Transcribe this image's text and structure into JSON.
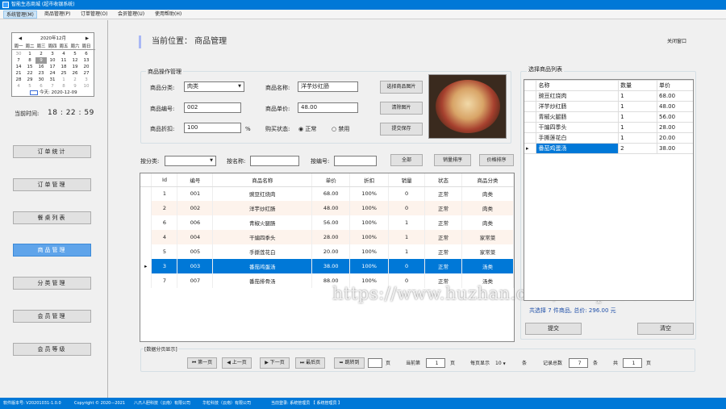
{
  "window": {
    "title": "智能生态商城 (超市收银系统)"
  },
  "menu": [
    "系统管理(M)",
    "商品管理(P)",
    "订单管理(O)",
    "会员管理(U)",
    "使用帮助(H)"
  ],
  "calendar": {
    "month_label": "2020年12月",
    "weekdays": [
      "周一",
      "周二",
      "周三",
      "周四",
      "周五",
      "周六",
      "周日"
    ],
    "rows": [
      [
        "30",
        "1",
        "2",
        "3",
        "4",
        "5",
        "6"
      ],
      [
        "7",
        "8",
        "9",
        "10",
        "11",
        "12",
        "13"
      ],
      [
        "14",
        "15",
        "16",
        "17",
        "18",
        "19",
        "20"
      ],
      [
        "21",
        "22",
        "23",
        "24",
        "25",
        "26",
        "27"
      ],
      [
        "28",
        "29",
        "30",
        "31",
        "1",
        "2",
        "3"
      ],
      [
        "4",
        "5",
        "6",
        "7",
        "8",
        "9",
        "10"
      ]
    ],
    "today_label": "今天: 2020-12-09"
  },
  "time": {
    "label": "当前时间:",
    "value": "18 : 22 : 59"
  },
  "nav": [
    "订单统计",
    "订单管理",
    "餐桌列表",
    "商品管理",
    "分类管理",
    "会员管理",
    "会员等级"
  ],
  "header": {
    "location": "当前位置：  商品管理",
    "close": "关闭窗口"
  },
  "product_form": {
    "group_title": "商品操作管理",
    "category_label": "商品分类:",
    "category_value": "肉类",
    "name_label": "商品名称:",
    "name_value": "洋芋炒红肠",
    "code_label": "商品编号:",
    "code_value": "002",
    "price_label": "商品单价:",
    "price_value": "48.00",
    "discount_label": "商品折扣:",
    "discount_value": "100",
    "percent": "%",
    "status_label": "购买状态:",
    "status_normal": "正常",
    "status_disabled": "禁用",
    "btn_select_image": "选择商品图片",
    "btn_clear_image": "清除图片",
    "btn_save": "提交保存"
  },
  "filters": {
    "by_category": "按分类:",
    "by_name": "按名称:",
    "by_code": "按编号:",
    "btn_all": "全部",
    "btn_sort_sales": "销量排序",
    "btn_sort_price": "价格排序"
  },
  "product_table": {
    "headers": [
      "Id",
      "编号",
      "商品名称",
      "单价",
      "折扣",
      "销量",
      "状态",
      "商品分类"
    ],
    "rows": [
      [
        "1",
        "001",
        "豌豆红烧肉",
        "68.00",
        "100%",
        "0",
        "正常",
        "肉类"
      ],
      [
        "2",
        "002",
        "洋芋炒红肠",
        "48.00",
        "100%",
        "0",
        "正常",
        "肉类"
      ],
      [
        "6",
        "006",
        "青椒火腿肠",
        "56.00",
        "100%",
        "1",
        "正常",
        "肉类"
      ],
      [
        "4",
        "004",
        "干煸四季头",
        "28.00",
        "100%",
        "1",
        "正常",
        "家常菜"
      ],
      [
        "5",
        "005",
        "手撕莲花白",
        "20.00",
        "100%",
        "1",
        "正常",
        "家常菜"
      ],
      [
        "3",
        "003",
        "番茄鸡蛋汤",
        "38.00",
        "100%",
        "0",
        "正常",
        "汤类"
      ],
      [
        "7",
        "007",
        "番茄排骨汤",
        "88.00",
        "100%",
        "0",
        "正常",
        "汤类"
      ]
    ]
  },
  "pager": {
    "title": "[数据分页显示]",
    "first": "第一页",
    "prev": "上一页",
    "next": "下一页",
    "last": "最后页",
    "jump": "跳转到",
    "page_unit": "页",
    "current_label": "当前第",
    "current": "1",
    "per_page_label": "每页显示",
    "per_page": "10",
    "per_unit": "条",
    "total_label": "记录总数",
    "total": "7",
    "total_unit": "条",
    "pages_label": "共",
    "pages": "1",
    "pages_unit": "页"
  },
  "cart": {
    "title": "选择商品列表",
    "headers": [
      "名称",
      "数量",
      "单价"
    ],
    "rows": [
      [
        "豌豆红烧肉",
        "1",
        "68.00"
      ],
      [
        "洋芋炒红肠",
        "1",
        "48.00"
      ],
      [
        "青椒火腿肠",
        "1",
        "56.00"
      ],
      [
        "干煸四季头",
        "1",
        "28.00"
      ],
      [
        "手撕莲花白",
        "1",
        "20.00"
      ],
      [
        "番茄鸡蛋汤",
        "2",
        "38.00"
      ]
    ],
    "summary": "共选择 7 件商品,  总价:  296.00  元",
    "btn_submit": "提交",
    "btn_clear": "清空"
  },
  "status_bar": {
    "version": "软件版本号: V20201031-1.0.0",
    "copyright": "Copyright © 2020—2021",
    "company1": "八爪人胆科技（云南）有限公司",
    "company2": "华粒科技（云南）有限公司",
    "login": "当前登录: 系统管理员 【 系统管理员 】"
  },
  "watermark": "https://www.huzhan.com/ishop9907",
  "colors": {
    "accent": "#0078d7",
    "selected_row": "#0078d7",
    "nav_active": "#5fa4ea",
    "alt_row": "#fdf3ec"
  }
}
